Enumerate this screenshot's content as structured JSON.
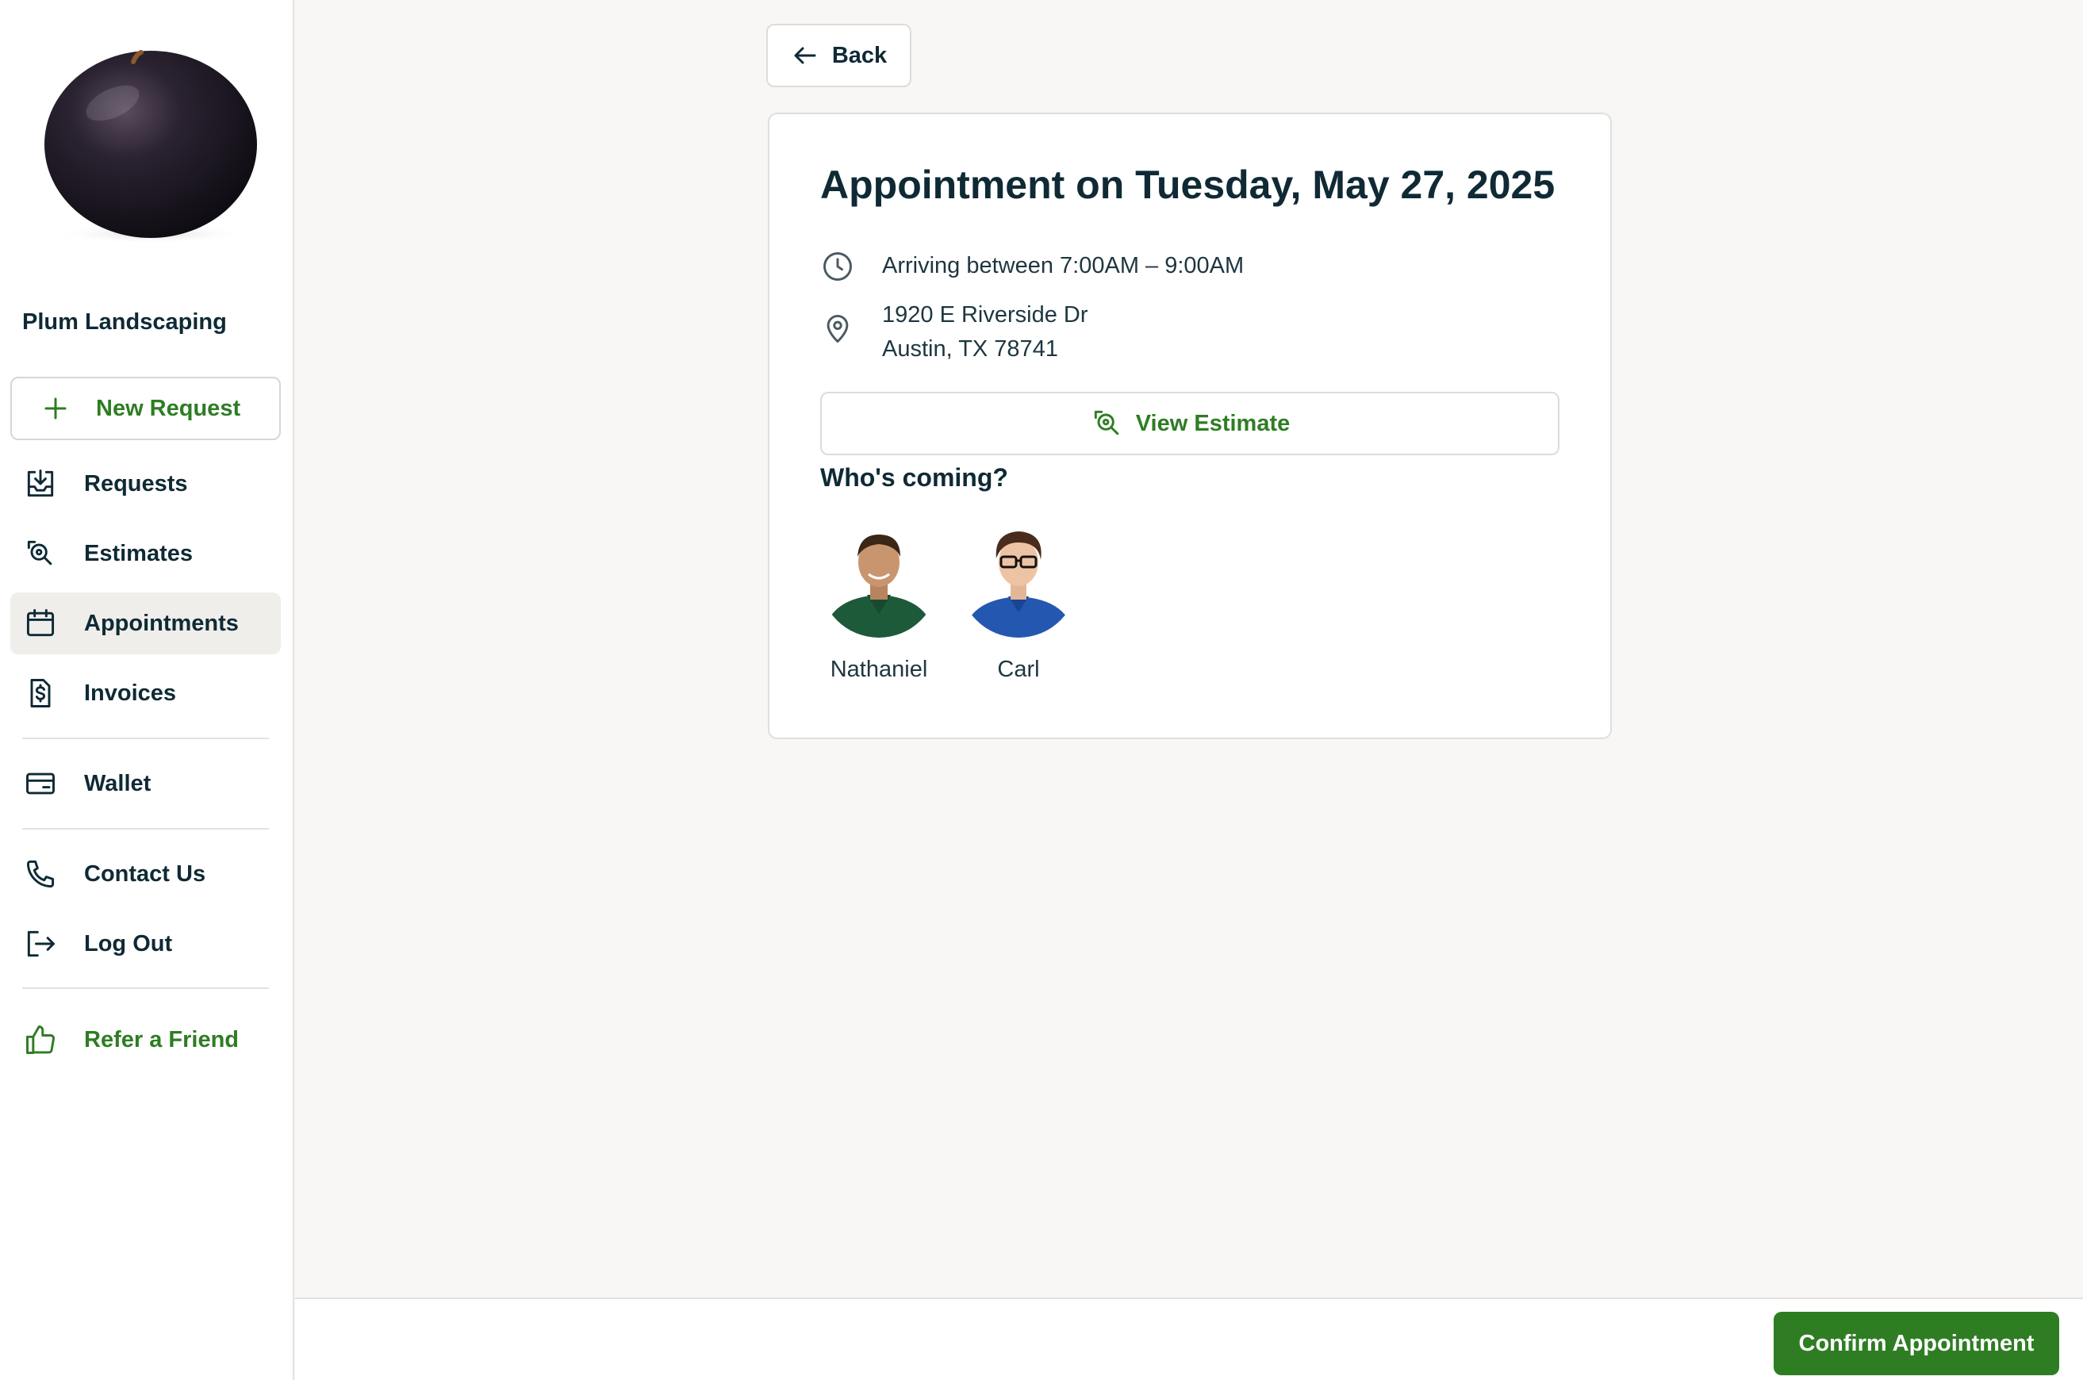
{
  "sidebar": {
    "company_name": "Plum Landscaping",
    "new_request_label": "New Request",
    "nav": {
      "requests": "Requests",
      "estimates": "Estimates",
      "appointments": "Appointments",
      "invoices": "Invoices",
      "wallet": "Wallet",
      "contact_us": "Contact Us",
      "log_out": "Log Out",
      "refer_a_friend": "Refer a Friend"
    },
    "active_item": "appointments",
    "icons": {
      "new_request": "plus-icon",
      "requests": "inbox-download-icon",
      "estimates": "estimate-search-icon",
      "appointments": "calendar-icon",
      "invoices": "invoice-dollar-icon",
      "wallet": "wallet-card-icon",
      "contact_us": "phone-icon",
      "log_out": "logout-icon",
      "refer_a_friend": "thumbs-up-icon"
    }
  },
  "back_label": "Back",
  "appointment": {
    "title": "Appointment on Tuesday, May 27, 2025",
    "arrival": "Arriving between 7:00AM – 9:00AM",
    "address_line1": "1920 E Riverside Dr",
    "address_line2": "Austin, TX 78741",
    "view_estimate_label": "View Estimate",
    "whos_coming_label": "Who's coming?",
    "crew": [
      {
        "name": "Nathaniel"
      },
      {
        "name": "Carl"
      }
    ]
  },
  "footer": {
    "confirm_label": "Confirm Appointment"
  },
  "colors": {
    "brand_green": "#2e7d23",
    "text_dark": "#0f2a35",
    "page_bg": "#f8f7f5",
    "active_nav_bg": "#efeeeb"
  }
}
